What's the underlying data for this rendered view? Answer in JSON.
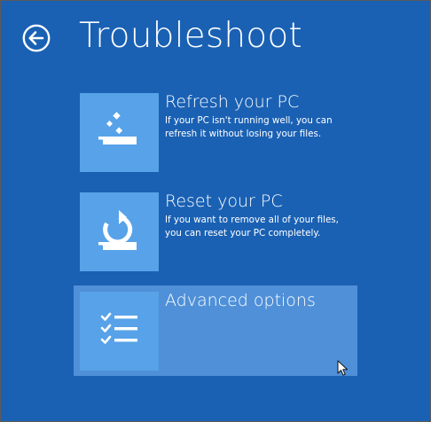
{
  "header": {
    "title": "Troubleshoot",
    "back_icon": "back-arrow-icon"
  },
  "options": [
    {
      "title": "Refresh your PC",
      "description_line1": "If your PC isn't running well, you can",
      "description_line2": "refresh it without losing your files.",
      "icon": "refresh-pc-icon"
    },
    {
      "title": "Reset your PC",
      "description_line1": "If you want to remove all of your files,",
      "description_line2": "you can reset your PC completely.",
      "icon": "reset-pc-icon"
    },
    {
      "title": "Advanced options",
      "icon": "checklist-icon",
      "selected": true
    }
  ],
  "colors": {
    "background": "#1a61b4",
    "tile": "#57a2e8",
    "selected_highlight": "#4f90d8",
    "text": "#ffffff"
  }
}
